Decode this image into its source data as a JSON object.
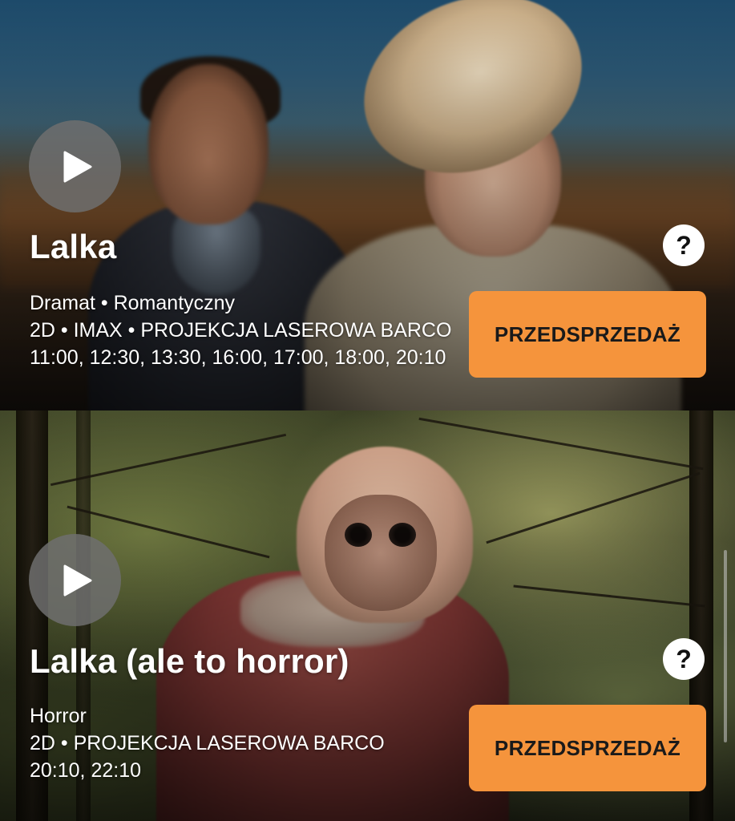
{
  "movies": [
    {
      "title": "Lalka",
      "genres": "Dramat • Romantyczny",
      "formats": "2D • IMAX • PROJEKCJA LASEROWA BARCO",
      "showtimes": "11:00, 12:30, 13:30, 16:00, 17:00, 18:00, 20:10",
      "play_icon": "play-icon",
      "help_label": "?",
      "presale_label": "PRZEDSPRZEDAŻ"
    },
    {
      "title": "Lalka (ale to horror)",
      "genres": "Horror",
      "formats": "2D • PROJEKCJA LASEROWA BARCO",
      "showtimes": "20:10, 22:10",
      "play_icon": "play-icon",
      "help_label": "?",
      "presale_label": "PRZEDSPRZEDAŻ"
    }
  ],
  "colors": {
    "presale_button": "#f5943c",
    "play_button": "#6e6e6e",
    "text": "#ffffff"
  }
}
